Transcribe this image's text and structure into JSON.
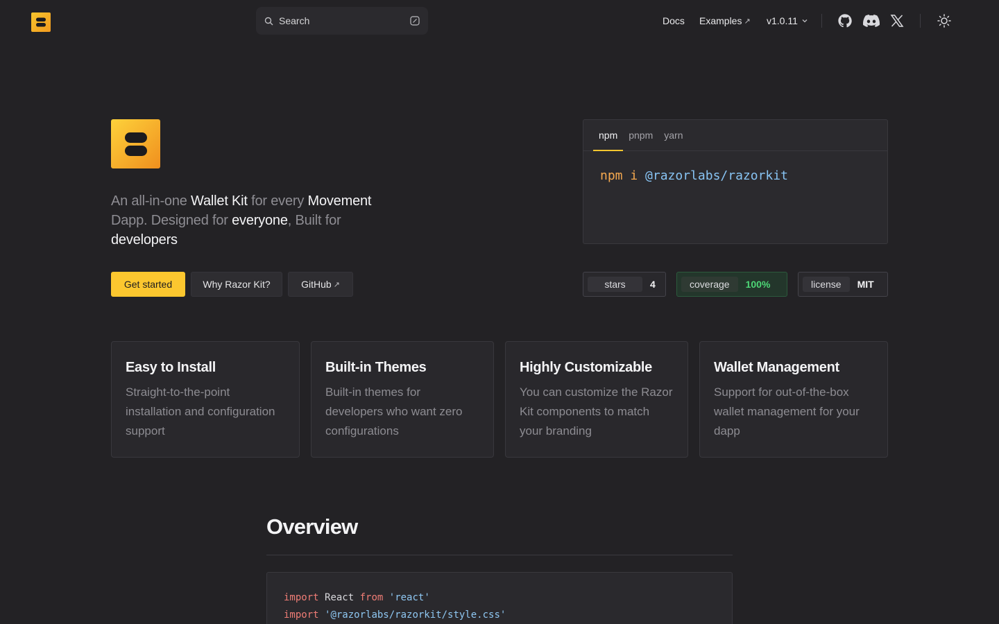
{
  "header": {
    "search_placeholder": "Search",
    "nav": {
      "docs": "Docs",
      "examples": "Examples",
      "version": "v1.0.11"
    },
    "icons": [
      "github-icon",
      "discord-icon",
      "x-icon",
      "sun-icon"
    ]
  },
  "hero": {
    "tagline": {
      "p1": "An all-in-one ",
      "h1": "Wallet Kit",
      "p2": " for every ",
      "h2": "Movement",
      "p3": " Dapp. Designed for ",
      "h3": "everyone",
      "p4": ", Built for ",
      "h4": "developers"
    },
    "buttons": {
      "get_started": "Get started",
      "why": "Why Razor Kit?",
      "github": "GitHub"
    }
  },
  "install": {
    "tabs": [
      "npm",
      "pnpm",
      "yarn"
    ],
    "active_tab": "npm",
    "cmd": "npm i",
    "pkg": "@razorlabs/razorkit"
  },
  "badges": {
    "stars": {
      "label": "stars",
      "value": "4"
    },
    "coverage": {
      "label": "coverage",
      "value": "100%"
    },
    "license": {
      "label": "license",
      "value": "MIT"
    }
  },
  "features": [
    {
      "title": "Easy to Install",
      "desc": "Straight-to-the-point installation and configuration support"
    },
    {
      "title": "Built-in Themes",
      "desc": "Built-in themes for developers who want zero configurations"
    },
    {
      "title": "Highly Customizable",
      "desc": "You can customize the Razor Kit components to match your branding"
    },
    {
      "title": "Wallet Management",
      "desc": "Support for out-of-the-box wallet management for your dapp"
    }
  ],
  "overview": {
    "heading": "Overview",
    "code": {
      "l1_kw": "import",
      "l1_id": "React",
      "l1_from": "from",
      "l1_str": "'react'",
      "l2_kw": "import",
      "l2_str": "'@razorlabs/razorkit/style.css'"
    }
  },
  "colors": {
    "background": "#232225",
    "accent": "#fcc72f",
    "success": "#4dd676"
  }
}
